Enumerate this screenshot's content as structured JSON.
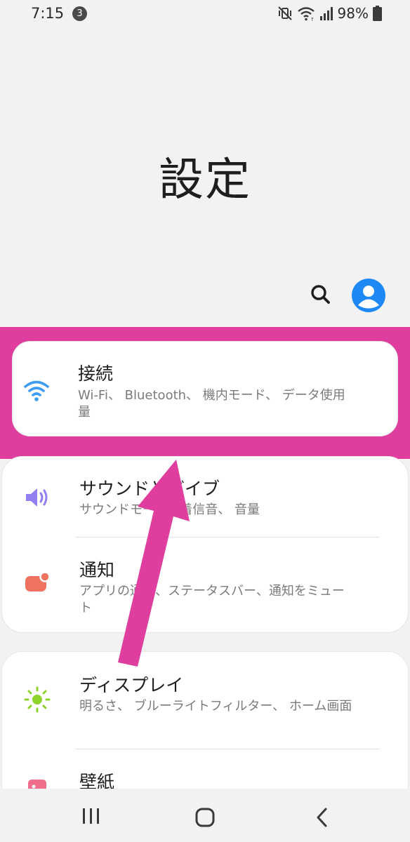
{
  "status_bar": {
    "time": "7:15",
    "notification_count": "3",
    "battery_percent": "98%",
    "icons": [
      "mute-vibrate-icon",
      "wifi-icon",
      "signal-icon",
      "battery-icon"
    ]
  },
  "header": {
    "title": "設定"
  },
  "toolbar": {
    "icons": [
      "search-icon",
      "profile-icon"
    ],
    "accent_color": "#1e88f5"
  },
  "highlight_color": "#e03e9e",
  "settings": [
    {
      "group": 1,
      "items": [
        {
          "icon": "wifi-icon",
          "icon_color": "#3d9bf0",
          "title": "接続",
          "subtitle": "Wi-Fi、 Bluetooth、 機内モード、 データ使用量"
        }
      ]
    },
    {
      "group": 2,
      "items": [
        {
          "icon": "speaker-icon",
          "icon_color": "#8f7ff0",
          "title": "サウンドとバイブ",
          "subtitle": "サウンドモード、着信音、 音量"
        },
        {
          "icon": "notification-icon",
          "icon_color": "#ef7260",
          "title": "通知",
          "subtitle": "アプリの通知、ステータスバー、通知をミュート"
        }
      ]
    },
    {
      "group": 3,
      "items": [
        {
          "icon": "brightness-icon",
          "icon_color": "#8ed22c",
          "title": "ディスプレイ",
          "subtitle": "明るさ、 ブルーライトフィルター、 ホーム画面"
        },
        {
          "icon": "wallpaper-icon",
          "icon_color": "#ef6f8a",
          "title": "壁紙",
          "subtitle": ""
        }
      ]
    }
  ],
  "nav_bar": {
    "icons": [
      "recents-icon",
      "home-icon",
      "back-icon"
    ]
  }
}
